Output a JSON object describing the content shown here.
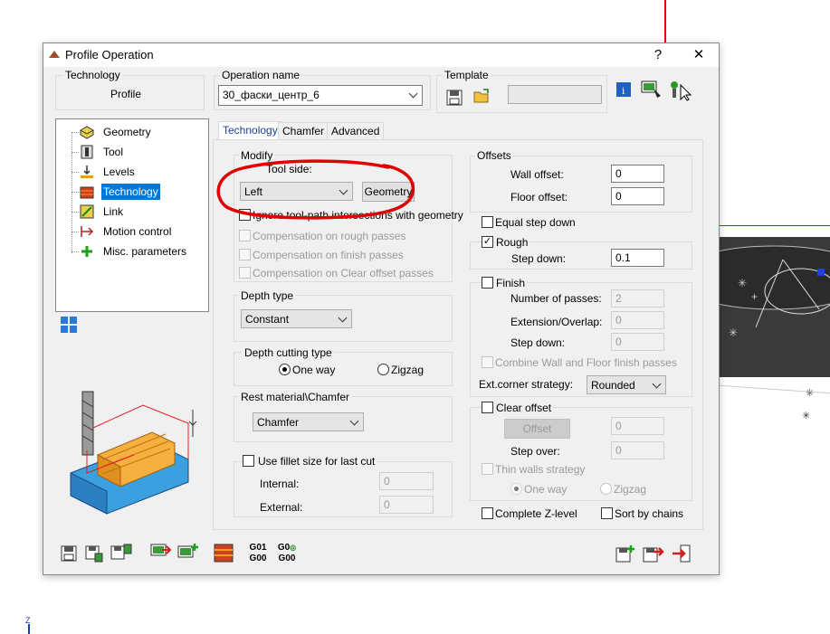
{
  "window": {
    "title": "Profile Operation",
    "help": "?",
    "close": "✕"
  },
  "technology_box": {
    "label": "Technology",
    "value": "Profile"
  },
  "operation_name": {
    "label": "Operation name",
    "value": "30_фаски_центр_6"
  },
  "template": {
    "label": "Template",
    "value": ""
  },
  "tree": {
    "items": [
      {
        "label": "Geometry",
        "icon": "geometry-icon"
      },
      {
        "label": "Tool",
        "icon": "tool-icon"
      },
      {
        "label": "Levels",
        "icon": "levels-icon"
      },
      {
        "label": "Technology",
        "icon": "technology-icon",
        "selected": true
      },
      {
        "label": "Link",
        "icon": "link-icon"
      },
      {
        "label": "Motion control",
        "icon": "motion-control-icon"
      },
      {
        "label": "Misc. parameters",
        "icon": "plus-icon"
      }
    ]
  },
  "tabs": [
    "Technology",
    "Chamfer",
    "Advanced"
  ],
  "modify": {
    "label": "Modify",
    "tool_side_label": "Tool side:",
    "tool_side_value": "Left",
    "geometry_button": "Geometry",
    "ignore_label": "Ignore tool-path intersections with geometry",
    "comp_rough": "Compensation on rough passes",
    "comp_finish": "Compensation on finish passes",
    "comp_clear": "Compensation on Clear offset passes"
  },
  "depth_type": {
    "label": "Depth type",
    "value": "Constant"
  },
  "depth_cutting": {
    "label": "Depth cutting type",
    "one_way": "One way",
    "zigzag": "Zigzag"
  },
  "rest_material": {
    "label": "Rest material\\Chamfer",
    "value": "Chamfer"
  },
  "fillet": {
    "label": "Use fillet size for last cut",
    "internal_label": "Internal:",
    "internal_value": "0",
    "external_label": "External:",
    "external_value": "0"
  },
  "offsets": {
    "label": "Offsets",
    "wall_label": "Wall offset:",
    "wall_value": "0",
    "floor_label": "Floor offset:",
    "floor_value": "0"
  },
  "equal_step": {
    "label": "Equal step down"
  },
  "rough": {
    "label": "Rough",
    "step_label": "Step down:",
    "step_value": "0.1"
  },
  "finish": {
    "label": "Finish",
    "passes_label": "Number of passes:",
    "passes_value": "2",
    "ext_label": "Extension/Overlap:",
    "ext_value": "0",
    "step_label": "Step down:",
    "step_value": "0",
    "combine_label": "Combine Wall and Floor finish passes",
    "corner_label": "Ext.corner strategy:",
    "corner_value": "Rounded"
  },
  "clear_offset": {
    "label": "Clear offset",
    "offset_button": "Offset",
    "offset_value": "0",
    "step_over_label": "Step over:",
    "step_over_value": "0",
    "thin_walls": "Thin walls strategy",
    "one_way": "One way",
    "zigzag": "Zigzag"
  },
  "complete_z": {
    "label": "Complete Z-level"
  },
  "sort_chains": {
    "label": "Sort by chains"
  },
  "footer": {
    "g01": "G01",
    "g00a": "G00",
    "g0": "G0",
    "g00b": "G00"
  },
  "scene": {
    "axis_label": "Z"
  },
  "colors": {
    "accent": "#0078d7",
    "annotation": "#e00000"
  }
}
